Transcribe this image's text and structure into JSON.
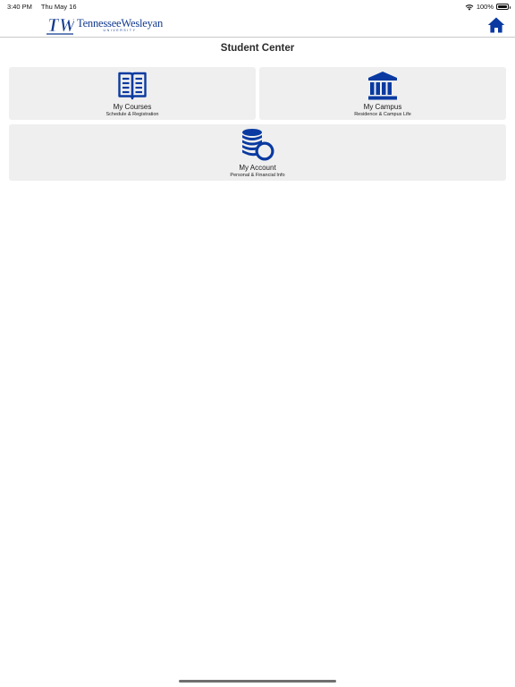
{
  "status_bar": {
    "time": "3:40 PM",
    "date": "Thu May 16",
    "battery": "100%",
    "battery_level": 1.0
  },
  "header": {
    "logo_monogram": "TW",
    "logo_name": "TennesseeWesleyan",
    "logo_sub": "UNIVERSITY",
    "home_icon": "home-icon"
  },
  "page": {
    "title": "Student Center"
  },
  "tiles": [
    {
      "title": "My Courses",
      "subtitle": "Schedule & Registration",
      "icon": "book-icon"
    },
    {
      "title": "My Campus",
      "subtitle": "Residence & Campus Life",
      "icon": "building-icon"
    },
    {
      "title": "My Account",
      "subtitle": "Personal & Financial Info",
      "icon": "coins-icon"
    }
  ],
  "colors": {
    "brand_blue": "#123a8f",
    "icon_blue": "#0a3aa1",
    "tile_background": "#efefef"
  }
}
